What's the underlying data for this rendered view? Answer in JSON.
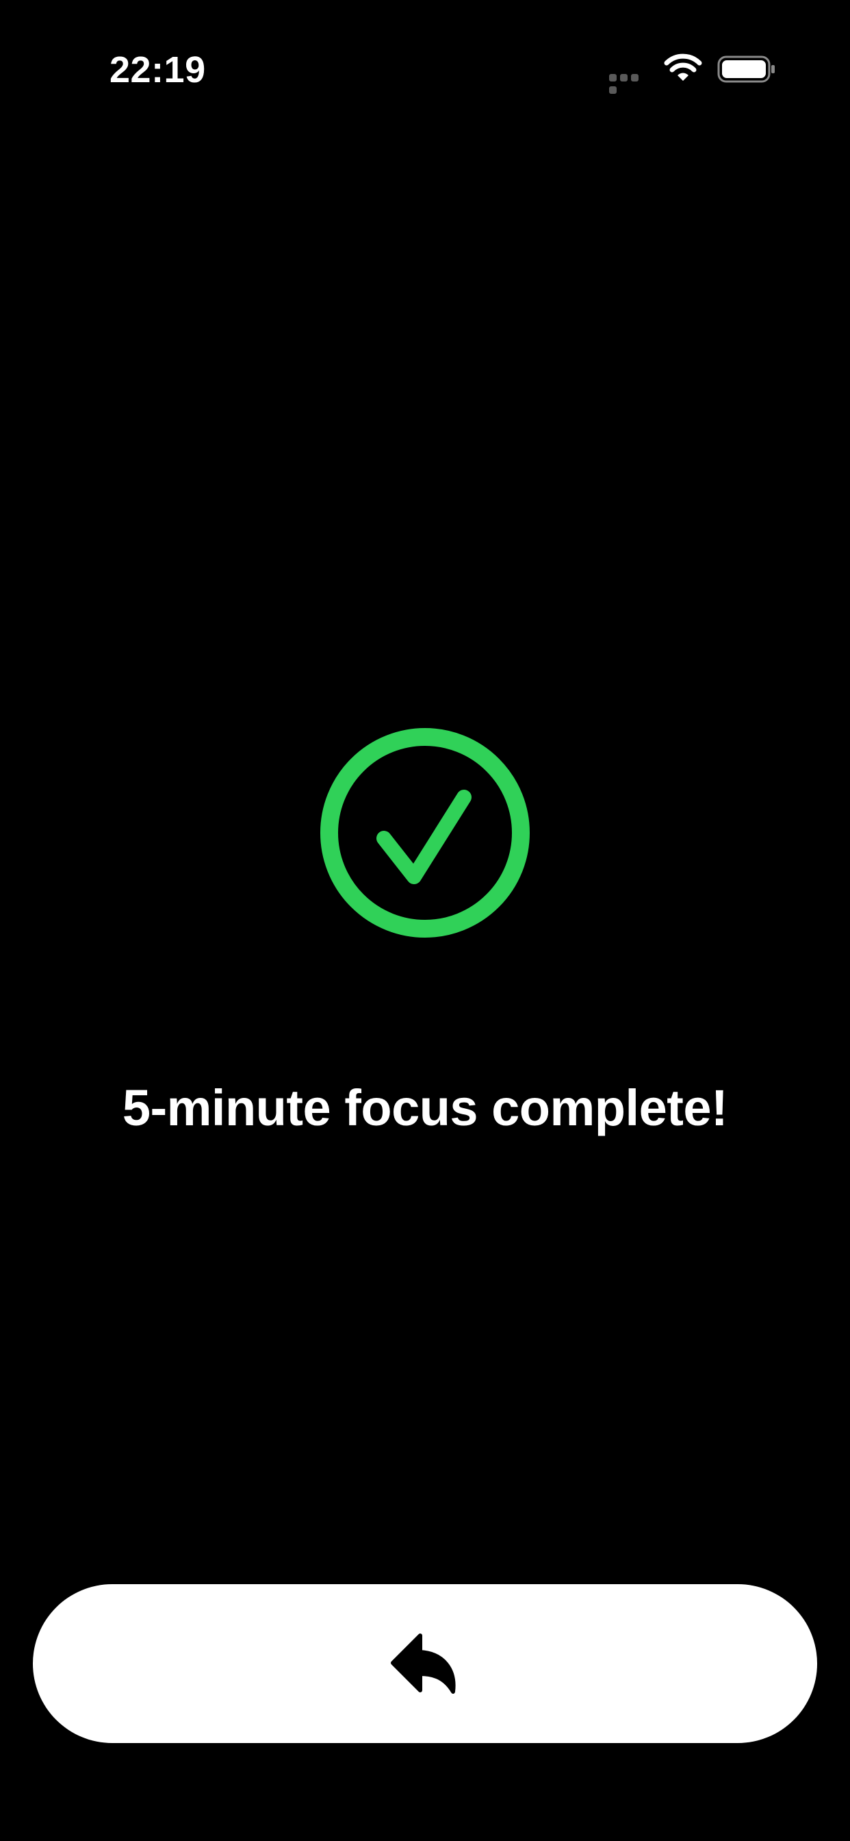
{
  "status_bar": {
    "time": "22:19",
    "icons": [
      "signal-dots-icon",
      "wifi-icon",
      "battery-icon"
    ]
  },
  "main": {
    "icon": "checkmark-circle-icon",
    "message": "5-minute focus complete!"
  },
  "footer": {
    "button_icon": "back-arrow-icon"
  },
  "colors": {
    "background": "#000000",
    "accent": "#30D158",
    "text": "#FFFFFF",
    "button_bg": "#FFFFFF",
    "button_icon": "#000000"
  }
}
